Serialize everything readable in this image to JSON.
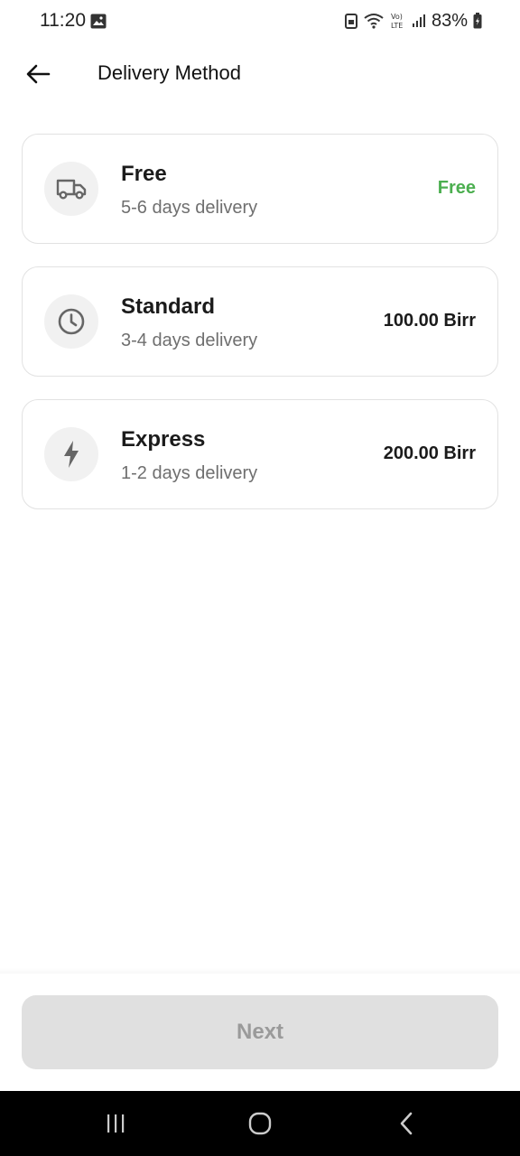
{
  "status_bar": {
    "time": "11:20",
    "battery": "83%"
  },
  "header": {
    "title": "Delivery Method"
  },
  "methods": [
    {
      "name": "Free",
      "description": "5-6 days delivery",
      "price": "Free",
      "icon": "truck-icon",
      "price_color": "#4caf50"
    },
    {
      "name": "Standard",
      "description": "3-4 days delivery",
      "price": "100.00 Birr",
      "icon": "clock-icon",
      "price_color": "#1b1b1b"
    },
    {
      "name": "Express",
      "description": "1-2 days delivery",
      "price": "200.00 Birr",
      "icon": "lightning-icon",
      "price_color": "#1b1b1b"
    }
  ],
  "footer": {
    "next_label": "Next"
  },
  "colors": {
    "accent_free": "#4caf50",
    "button_disabled_bg": "#e0e0e0",
    "button_disabled_text": "#9a9a9a"
  }
}
